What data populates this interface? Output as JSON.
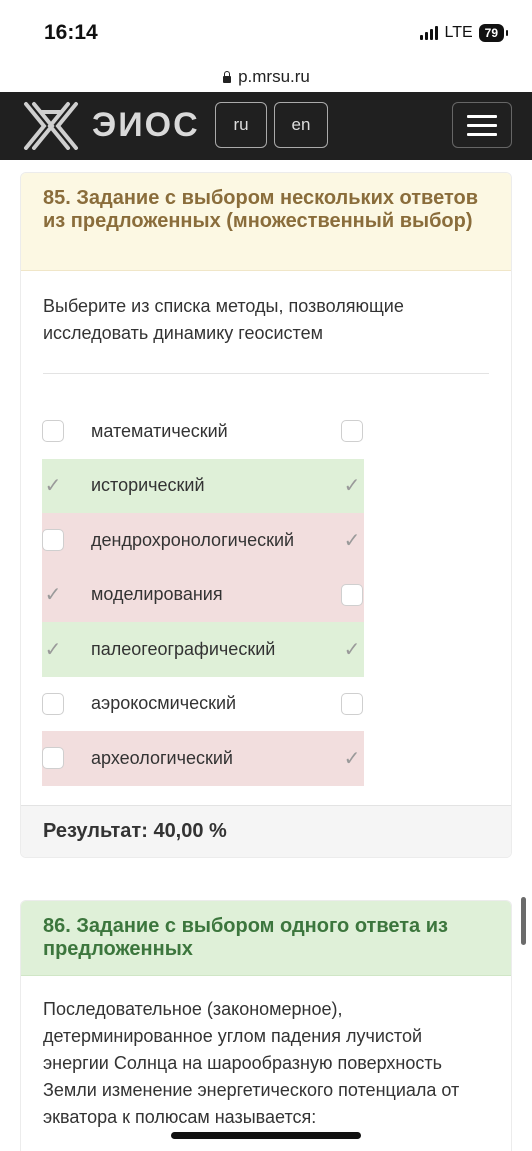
{
  "status_bar": {
    "time": "16:14",
    "network": "LTE",
    "battery": "79"
  },
  "browser": {
    "url": "p.mrsu.ru"
  },
  "header": {
    "logo_text": "ЭИОС",
    "lang_ru": "ru",
    "lang_en": "en"
  },
  "question85": {
    "title": "85. Задание с выбором нескольких ответов из предложенных (множественный выбор)",
    "text": "Выберите из списка методы, позволяющие исследовать динамику геосистем",
    "options": [
      {
        "label": "математический",
        "user_checked": false,
        "correct_checked": false,
        "state": "neutral"
      },
      {
        "label": "исторический",
        "user_checked": true,
        "correct_checked": true,
        "state": "correct"
      },
      {
        "label": "дендрохронологический",
        "user_checked": false,
        "correct_checked": true,
        "state": "wrong"
      },
      {
        "label": "моделирования",
        "user_checked": true,
        "correct_checked": false,
        "state": "wrong"
      },
      {
        "label": "палеогеографический",
        "user_checked": true,
        "correct_checked": true,
        "state": "correct"
      },
      {
        "label": "аэрокосмический",
        "user_checked": false,
        "correct_checked": false,
        "state": "neutral"
      },
      {
        "label": "археологический",
        "user_checked": false,
        "correct_checked": true,
        "state": "wrong"
      }
    ],
    "result": "Результат: 40,00 %"
  },
  "question86": {
    "title": "86. Задание с выбором одного ответа из предложенных",
    "text": "Последовательное (закономерное), детерминированное углом падения лучистой энергии Солнца на шарообразную поверхность Земли изменение энергетического потенциала от экватора к полюсам называется:"
  },
  "colors": {
    "correct_bg": "#dff0d8",
    "wrong_bg": "#f2dede",
    "warning_bg": "#fcf8e3",
    "header_bg": "#202020"
  }
}
